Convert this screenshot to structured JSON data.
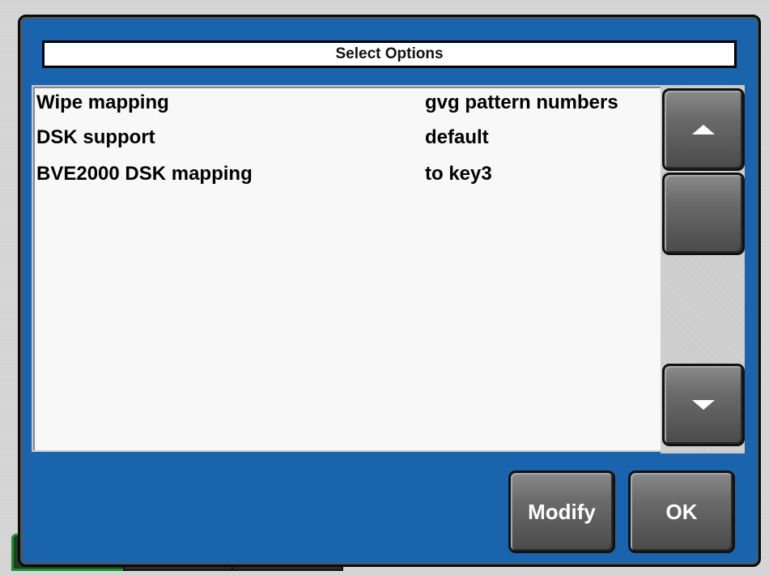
{
  "dialog": {
    "title": "Select Options",
    "accent_color": "#1a64ae"
  },
  "options": [
    {
      "name": "Wipe mapping",
      "value": "gvg pattern numbers"
    },
    {
      "name": "DSK support",
      "value": "default"
    },
    {
      "name": "BVE2000 DSK mapping",
      "value": "to key3"
    }
  ],
  "scrollbar": {
    "up_icon": "triangle-up-icon",
    "down_icon": "triangle-down-icon"
  },
  "buttons": {
    "modify_label": "Modify",
    "ok_label": "OK"
  }
}
